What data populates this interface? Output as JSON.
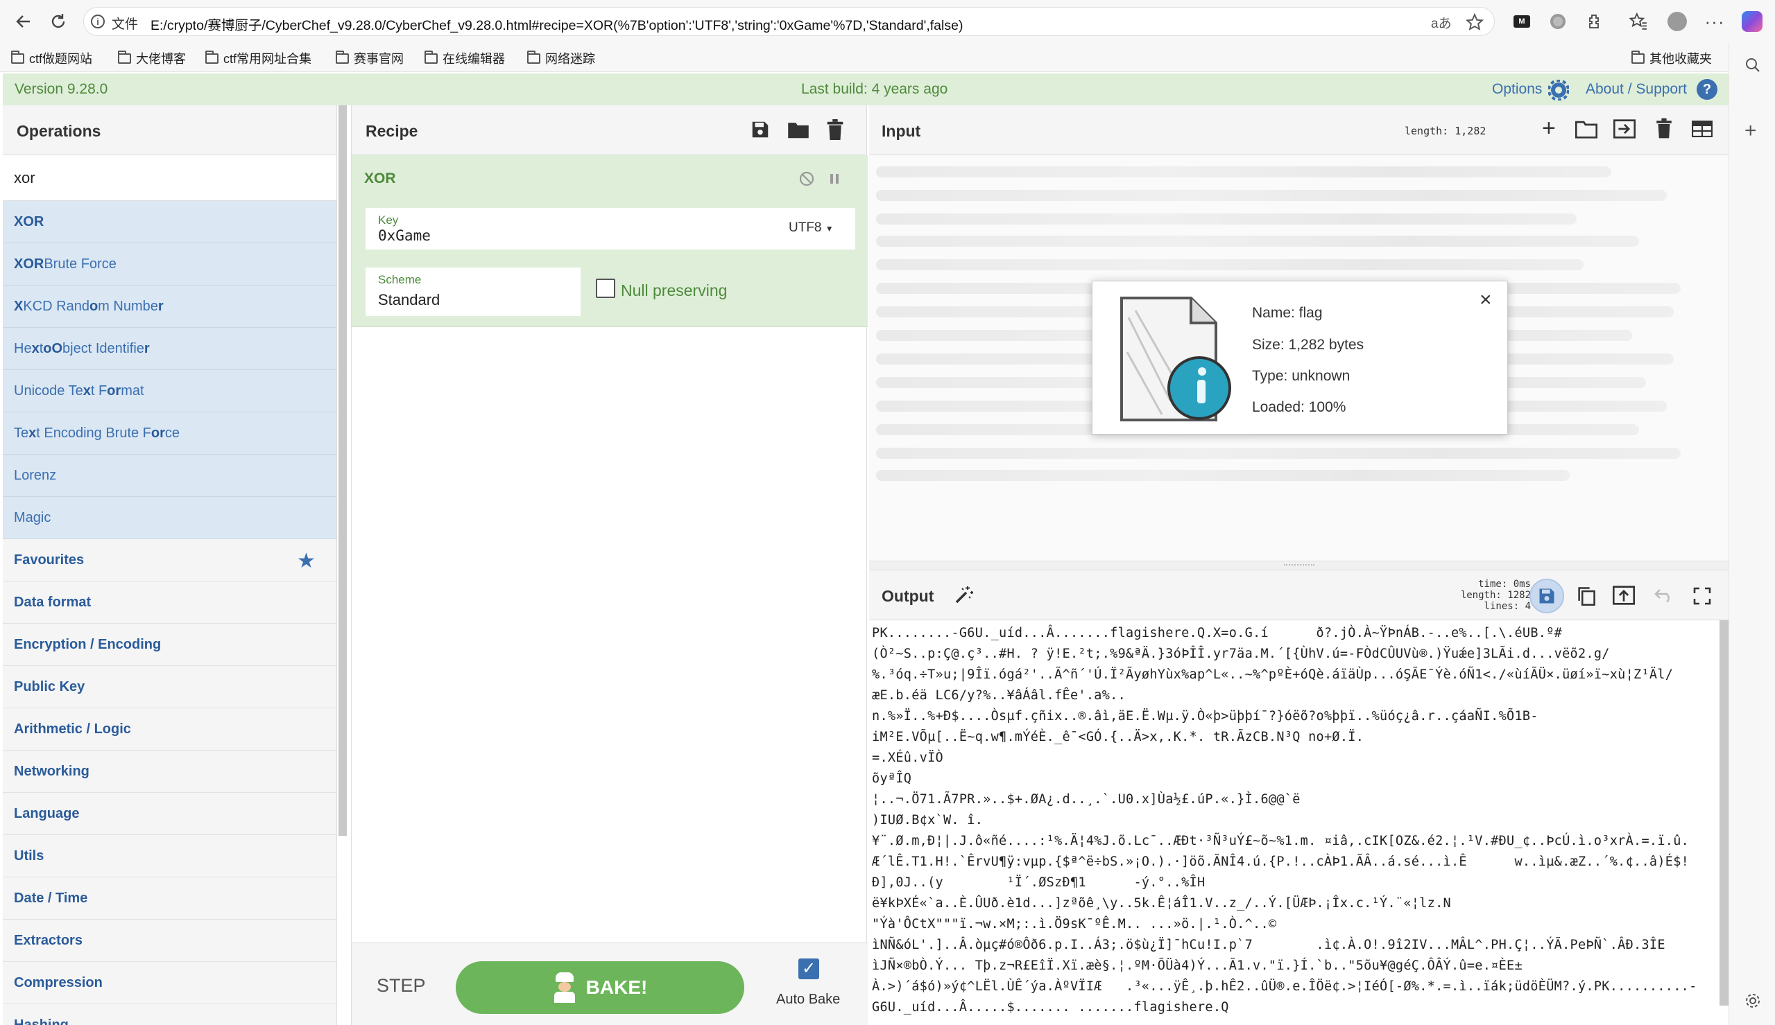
{
  "browser": {
    "url_prefix": "文件",
    "url": "E:/crypto/赛博厨子/CyberChef_v9.28.0/CyberChef_v9.28.0.html#recipe=XOR(%7B'option':'UTF8','string':'0xGame'%7D,'Standard',false)",
    "bookmarks": [
      "ctf做题网站",
      "大佬博客",
      "ctf常用网址合集",
      "赛事官网",
      "在线编辑器",
      "网络迷踪"
    ],
    "other_bookmarks": "其他收藏夹"
  },
  "banner": {
    "version": "Version 9.28.0",
    "last_build": "Last build: 4 years ago",
    "options": "Options",
    "about": "About / Support"
  },
  "operations": {
    "title": "Operations",
    "search": "xor",
    "results": [
      {
        "bold": "XOR",
        "rest": ""
      },
      {
        "bold": "XOR",
        "rest": " Brute Force"
      },
      {
        "html": "<b>X</b>KCD Rand<b>o</b>m Numbe<b>r</b>"
      },
      {
        "html": "He<b>x</b> t<b>o</b> <b>O</b>bject Identifie<b>r</b>"
      },
      {
        "html": "Unicode Te<b>x</b>t F<b>o</b><b>r</b>mat"
      },
      {
        "html": "Te<b>x</b>t Encoding Brute F<b>o</b><b>r</b>ce"
      },
      {
        "html": "Lorenz"
      },
      {
        "html": "Magic"
      }
    ],
    "categories": [
      "Favourites",
      "Data format",
      "Encryption / Encoding",
      "Public Key",
      "Arithmetic / Logic",
      "Networking",
      "Language",
      "Utils",
      "Date / Time",
      "Extractors",
      "Compression",
      "Hashing"
    ]
  },
  "recipe": {
    "title": "Recipe",
    "op_name": "XOR",
    "key_label": "Key",
    "key_value": "0xGame",
    "key_encoding": "UTF8",
    "scheme_label": "Scheme",
    "scheme_value": "Standard",
    "null_label": "Null preserving",
    "step": "STEP",
    "bake": "BAKE!",
    "auto_bake": "Auto Bake"
  },
  "input": {
    "title": "Input",
    "length": "length: 1,282",
    "file": {
      "name": "Name: flag",
      "size": "Size: 1,282 bytes",
      "type": "Type: unknown",
      "loaded": "Loaded: 100%"
    }
  },
  "output": {
    "title": "Output",
    "time": "time:",
    "time_val": "0ms",
    "length": "length:",
    "length_val": "1282",
    "lines": "lines:",
    "lines_val": "4",
    "text_lines": [
      "PK........-G6U._uíd...Â.......flagishere.Q.X=o.G.í      ð?.jÒ.À~ŸÞnÁB.-..e%..[.\\.éUB.º#",
      "(Ò²~S..p:Ç@.ç³..#H. ? ÿ!E.²t;.%9&ªÄ.}3óÞÎÎ.yr7äa.M.´[{ÙhV.ú=-FÒdCÛUVù®.)Ÿuǽe]3LÃi.d...vëõ2.g/",
      "%.³óq.÷T»u;|9Îï.ógá²'..Ã^ñ´'Ú.Ï²ÃyøhYùx%ap^L«..~%^pºÈ+óQè.áïäÙp...óŞÃE¯Ýè.óÑ1<./«ùíÃÜ×.üøí»ï~xù¦Z¹Äl/",
      "æE.b.éä LC6/y?%..¥âÁâl.fÊe'.a%..",
      "n.%»Ï..%+Ð$....Òsµf.çñix..®.âì,äE.Ë.Wµ.ÿ.Ò«þ>üþþí¯?}óëõ?o%þþï..%üóç¿â.r..çáaÑI.%Õ1B-",
      "iM²E.VÕµ[..Ë~q.w¶.mÝéÈ._ê¯<GÓ.{..Ä>x,.K.*. tR.ÃzCB.N³Q no+Ø.Ï.",
      "=.XÉû.vÏÒ",
      "õyªÎQ",
      "¦..¬.Ö71.Ã7PR.»..$+.ØA¿.d..¸.`.U0.x]Ùa½£.úP.«.}Ì.6@@`ë",
      ")IUØ.B¢x`W. î.",
      "¥¨.Ø.m,Ð¦|.J.ô«ñé....:¹%.Ä¦4%J.õ.Lc¯..ÆÐt·³Ñ³uÝ£~õ~%1.m. ¤iâ,.cIK[OZ&.é2.¦.¹V.#ÐU_¢..ÞcÚ.ì.o³xrÀ.=.ï.û.",
      "Æ´lÊ.T1.H!.`ÊrvU¶ÿ:vµp.{$ª^ë÷bS.»¡O.).·]öõ.ÃNÎ4.ú.{P.!..cÀÞ1.ÃÂ..á.sé...ì.Ê      w..ìµ&.æZ..´%.¢..â)É$!",
      "Ð],0J..(y        ¹Ï´.ØSzÐ¶1      -ý.°..%ÎH",
      "ë¥kÞXÉ«`a..È.ÛUð.è1d...]zªõê¸\\y..5k.Ê¦áÎ1.V..z_/..Ý.[ÜÆÞ.¡Îx.c.¹Ý.¨«¦lz.N",
      "\"Ýà'ÔCtX\"\"\"ï.¬w.×M;:.ì.Ö9sK¯ºÊ.M.. ...»ö.|.¹.Ò.^..©",
      "ìNÑ&óL'.]..Â.òµç#ó®Ôð6.p.I..Á3;.ö$ù¿Ï]¯hCu!I.p`7        .ì¢.À.O!.9î2IV...MÂL^.PH.Ç¦..ÝÃ.PeÞÑ`.ÂÐ.3ÎE",
      "ìJÑ×®bÒ.Ý... Tþ.z¬R£EîÏ.Xï.æè§.¦.ºM·ÕÜà4)Ý...Ã1.v.\"ï.}Í.`b..\"5õu¥@géÇ.ÔÂÝ.û=e.¤ÈE±",
      "À.>)´á$ó)»ý¢^LËl.ÙÊ´ýa.ÀºVÏIÆ   .³«...ÿÊ¸.þ.hÊ2..ûÜ®.e.ÎÖë¢.>¦IéÓ[-Ø%.*.=.ì..ïák;üdöÈÜM?.ý.PK..........-",
      "G6U._uíd...Â.....$....... .......flagishere.Q"
    ]
  }
}
